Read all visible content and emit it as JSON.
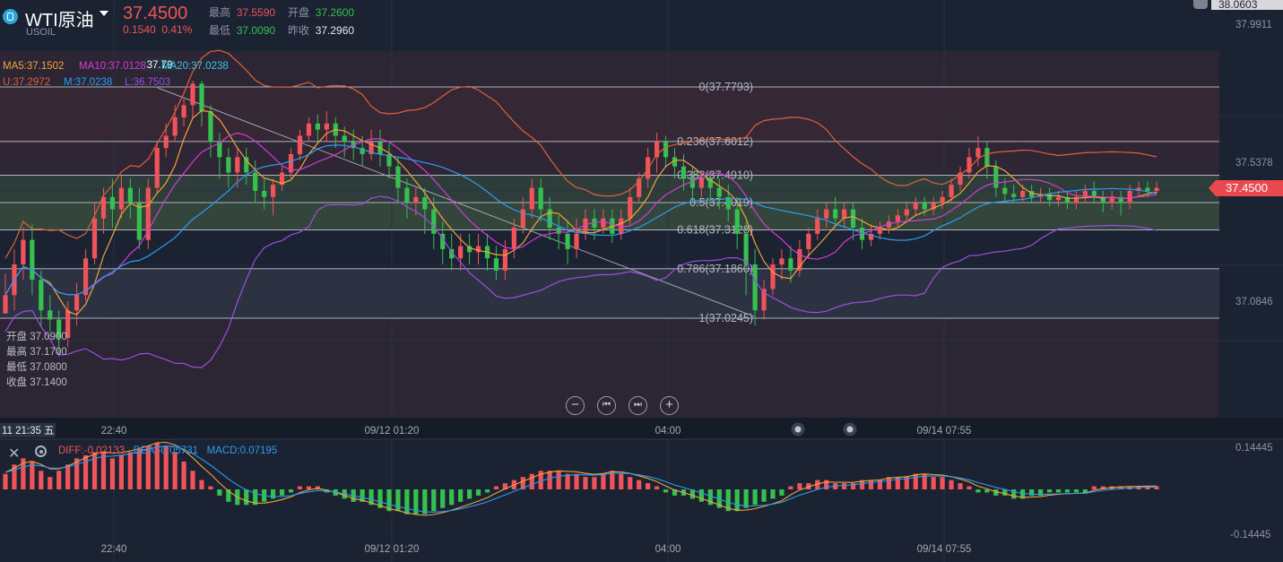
{
  "header": {
    "symbol": "WTI原油",
    "symbol_code": "USOIL",
    "price": "37.4500",
    "change": "0.1540",
    "change_pct": "0.41%",
    "high_label": "最高",
    "high": "37.5590",
    "open_label": "开盘",
    "open": "37.2600",
    "low_label": "最低",
    "low": "37.0090",
    "prev_label": "昨收",
    "prev": "37.2960"
  },
  "indicators": {
    "ma5": "MA5:37.1502",
    "ma10": "MA10:37.0128",
    "ma20": "MA20:37.0238",
    "boll_u": "U:37.2972",
    "boll_m": "M:37.0238",
    "boll_l": "L:36.7503"
  },
  "cursor": {
    "time": "11 21:35 五",
    "open": "开盘 37.0900",
    "high": "最高 37.1700",
    "low": "最低 37.0800",
    "close": "收盘 37.1400"
  },
  "macd": {
    "diff": "DIFF:-0.02133",
    "dea": "DEA:-0.05731",
    "macd": "MACD:0.07195",
    "axis_top": "0.14445",
    "axis_bottom": "-0.14445"
  },
  "controls": {
    "zoom_out": "−",
    "prev": "⏮",
    "next": "⏭",
    "zoom_in": "+"
  },
  "colors": {
    "up": "#f0545a",
    "down": "#35c04f",
    "ma5": "#f3a33b",
    "ma10": "#d53ad8",
    "ma20": "#2d9cf0",
    "boll_u": "#e0603c",
    "boll_l": "#9b4fe0"
  },
  "chart_data": {
    "type": "candlestick",
    "x_tick_labels": [
      "22:40",
      "09/12 01:20",
      "04:00",
      "09/14 07:55"
    ],
    "y_tick_labels": [
      "37.9911",
      "37.5378",
      "37.0846"
    ],
    "y_top_label": "38.0603",
    "current_price": "37.4500",
    "high_marker": "37.79",
    "ylim": [
      36.7,
      38.0
    ],
    "fibonacci": [
      {
        "label": "0(37.7793)",
        "value": 37.7793
      },
      {
        "label": "0.236(37.6012)",
        "value": 37.6012
      },
      {
        "label": "0.382(37.4910)",
        "value": 37.491
      },
      {
        "label": "0.5(37.4019)",
        "value": 37.4019
      },
      {
        "label": "0.618(37.3128)",
        "value": 37.3128
      },
      {
        "label": "0.786(37.1860)",
        "value": 37.186
      },
      {
        "label": "1(37.0245)",
        "value": 37.0245
      }
    ],
    "candles": [
      [
        37.04,
        37.1,
        37.09,
        37.17
      ],
      [
        37.1,
        37.2,
        37.05,
        37.25
      ],
      [
        37.2,
        37.28,
        37.15,
        37.32
      ],
      [
        37.28,
        37.15,
        37.1,
        37.33
      ],
      [
        37.15,
        37.05,
        37.0,
        37.18
      ],
      [
        37.05,
        37.02,
        36.98,
        37.1
      ],
      [
        37.02,
        36.96,
        36.9,
        37.05
      ],
      [
        36.96,
        37.05,
        36.93,
        37.08
      ],
      [
        37.05,
        37.1,
        37.0,
        37.14
      ],
      [
        37.1,
        37.22,
        37.08,
        37.25
      ],
      [
        37.22,
        37.35,
        37.2,
        37.4
      ],
      [
        37.35,
        37.42,
        37.3,
        37.45
      ],
      [
        37.42,
        37.38,
        37.32,
        37.48
      ],
      [
        37.38,
        37.45,
        37.35,
        37.49
      ],
      [
        37.45,
        37.4,
        37.35,
        37.48
      ],
      [
        37.4,
        37.28,
        37.25,
        37.45
      ],
      [
        37.28,
        37.45,
        37.25,
        37.48
      ],
      [
        37.45,
        37.58,
        37.43,
        37.6
      ],
      [
        37.58,
        37.62,
        37.55,
        37.66
      ],
      [
        37.62,
        37.68,
        37.6,
        37.72
      ],
      [
        37.68,
        37.72,
        37.65,
        37.74
      ],
      [
        37.72,
        37.79,
        37.68,
        37.8
      ],
      [
        37.79,
        37.7,
        37.65,
        37.8
      ],
      [
        37.7,
        37.6,
        37.55,
        37.72
      ],
      [
        37.6,
        37.55,
        37.48,
        37.63
      ],
      [
        37.55,
        37.5,
        37.45,
        37.58
      ],
      [
        37.5,
        37.55,
        37.45,
        37.58
      ],
      [
        37.55,
        37.5,
        37.46,
        37.58
      ],
      [
        37.5,
        37.44,
        37.4,
        37.54
      ],
      [
        37.44,
        37.42,
        37.38,
        37.48
      ],
      [
        37.42,
        37.46,
        37.36,
        37.48
      ],
      [
        37.46,
        37.5,
        37.44,
        37.52
      ],
      [
        37.5,
        37.56,
        37.48,
        37.58
      ],
      [
        37.56,
        37.62,
        37.54,
        37.64
      ],
      [
        37.62,
        37.66,
        37.6,
        37.68
      ],
      [
        37.66,
        37.64,
        37.6,
        37.69
      ],
      [
        37.64,
        37.66,
        37.6,
        37.7
      ],
      [
        37.66,
        37.62,
        37.58,
        37.68
      ],
      [
        37.62,
        37.6,
        37.55,
        37.65
      ],
      [
        37.6,
        37.58,
        37.54,
        37.64
      ],
      [
        37.58,
        37.56,
        37.52,
        37.62
      ],
      [
        37.56,
        37.6,
        37.54,
        37.64
      ],
      [
        37.6,
        37.56,
        37.52,
        37.64
      ],
      [
        37.56,
        37.52,
        37.48,
        37.6
      ],
      [
        37.52,
        37.45,
        37.4,
        37.55
      ],
      [
        37.45,
        37.4,
        37.35,
        37.48
      ],
      [
        37.4,
        37.42,
        37.36,
        37.45
      ],
      [
        37.42,
        37.38,
        37.3,
        37.45
      ],
      [
        37.38,
        37.3,
        37.25,
        37.42
      ],
      [
        37.3,
        37.25,
        37.2,
        37.34
      ],
      [
        37.25,
        37.22,
        37.18,
        37.3
      ],
      [
        37.22,
        37.26,
        37.18,
        37.3
      ],
      [
        37.26,
        37.24,
        37.2,
        37.3
      ],
      [
        37.24,
        37.26,
        37.2,
        37.3
      ],
      [
        37.26,
        37.22,
        37.18,
        37.3
      ],
      [
        37.22,
        37.18,
        37.15,
        37.26
      ],
      [
        37.18,
        37.25,
        37.15,
        37.28
      ],
      [
        37.25,
        37.32,
        37.22,
        37.35
      ],
      [
        37.32,
        37.38,
        37.3,
        37.42
      ],
      [
        37.38,
        37.45,
        37.35,
        37.48
      ],
      [
        37.45,
        37.38,
        37.34,
        37.48
      ],
      [
        37.38,
        37.32,
        37.28,
        37.42
      ],
      [
        37.32,
        37.3,
        37.25,
        37.36
      ],
      [
        37.3,
        37.25,
        37.2,
        37.34
      ],
      [
        37.25,
        37.3,
        37.22,
        37.35
      ],
      [
        37.3,
        37.35,
        37.28,
        37.38
      ],
      [
        37.35,
        37.32,
        37.28,
        37.38
      ],
      [
        37.32,
        37.35,
        37.3,
        37.38
      ],
      [
        37.35,
        37.3,
        37.27,
        37.38
      ],
      [
        37.3,
        37.35,
        37.28,
        37.38
      ],
      [
        37.35,
        37.42,
        37.33,
        37.45
      ],
      [
        37.42,
        37.48,
        37.4,
        37.5
      ],
      [
        37.48,
        37.55,
        37.45,
        37.58
      ],
      [
        37.55,
        37.6,
        37.5,
        37.63
      ],
      [
        37.6,
        37.55,
        37.52,
        37.62
      ],
      [
        37.55,
        37.52,
        37.48,
        37.58
      ],
      [
        37.52,
        37.48,
        37.44,
        37.56
      ],
      [
        37.48,
        37.45,
        37.4,
        37.52
      ],
      [
        37.45,
        37.48,
        37.42,
        37.5
      ],
      [
        37.48,
        37.45,
        37.4,
        37.5
      ],
      [
        37.45,
        37.42,
        37.38,
        37.48
      ],
      [
        37.42,
        37.38,
        37.34,
        37.46
      ],
      [
        37.38,
        37.3,
        37.25,
        37.42
      ],
      [
        37.3,
        37.2,
        37.1,
        37.34
      ],
      [
        37.2,
        37.05,
        37.0,
        37.25
      ],
      [
        37.05,
        37.12,
        37.02,
        37.15
      ],
      [
        37.12,
        37.2,
        37.1,
        37.22
      ],
      [
        37.2,
        37.22,
        37.15,
        37.25
      ],
      [
        37.22,
        37.18,
        37.14,
        37.26
      ],
      [
        37.18,
        37.25,
        37.16,
        37.28
      ],
      [
        37.25,
        37.3,
        37.22,
        37.32
      ],
      [
        37.3,
        37.35,
        37.28,
        37.38
      ],
      [
        37.35,
        37.38,
        37.32,
        37.4
      ],
      [
        37.38,
        37.35,
        37.32,
        37.42
      ],
      [
        37.35,
        37.38,
        37.32,
        37.4
      ],
      [
        37.38,
        37.32,
        37.28,
        37.4
      ],
      [
        37.32,
        37.28,
        37.25,
        37.35
      ],
      [
        37.28,
        37.3,
        37.26,
        37.33
      ],
      [
        37.3,
        37.32,
        37.28,
        37.34
      ],
      [
        37.32,
        37.34,
        37.3,
        37.36
      ],
      [
        37.34,
        37.36,
        37.32,
        37.38
      ],
      [
        37.36,
        37.38,
        37.34,
        37.4
      ],
      [
        37.38,
        37.4,
        37.36,
        37.42
      ],
      [
        37.4,
        37.38,
        37.36,
        37.42
      ],
      [
        37.38,
        37.4,
        37.36,
        37.42
      ],
      [
        37.4,
        37.42,
        37.38,
        37.44
      ],
      [
        37.42,
        37.46,
        37.4,
        37.48
      ],
      [
        37.46,
        37.5,
        37.44,
        37.52
      ],
      [
        37.5,
        37.55,
        37.48,
        37.58
      ],
      [
        37.55,
        37.58,
        37.52,
        37.62
      ],
      [
        37.58,
        37.52,
        37.48,
        37.6
      ],
      [
        37.52,
        37.45,
        37.42,
        37.54
      ],
      [
        37.45,
        37.43,
        37.4,
        37.48
      ],
      [
        37.43,
        37.42,
        37.4,
        37.46
      ],
      [
        37.42,
        37.44,
        37.4,
        37.46
      ],
      [
        37.44,
        37.42,
        37.4,
        37.46
      ],
      [
        37.42,
        37.43,
        37.4,
        37.45
      ],
      [
        37.43,
        37.41,
        37.39,
        37.45
      ],
      [
        37.41,
        37.42,
        37.39,
        37.44
      ],
      [
        37.42,
        37.4,
        37.38,
        37.44
      ],
      [
        37.4,
        37.42,
        37.38,
        37.44
      ],
      [
        37.42,
        37.44,
        37.4,
        37.46
      ],
      [
        37.44,
        37.42,
        37.4,
        37.47
      ],
      [
        37.42,
        37.4,
        37.37,
        37.44
      ],
      [
        37.4,
        37.42,
        37.38,
        37.44
      ],
      [
        37.42,
        37.4,
        37.36,
        37.44
      ],
      [
        37.4,
        37.44,
        37.38,
        37.46
      ],
      [
        37.44,
        37.45,
        37.42,
        37.47
      ],
      [
        37.45,
        37.44,
        37.42,
        37.47
      ],
      [
        37.44,
        37.45,
        37.43,
        37.47
      ]
    ],
    "macd_hist": [
      0.05,
      0.08,
      0.1,
      0.09,
      0.06,
      0.04,
      0.06,
      0.08,
      0.1,
      0.11,
      0.12,
      0.12,
      0.1,
      0.11,
      0.12,
      0.13,
      0.14,
      0.15,
      0.14,
      0.12,
      0.09,
      0.06,
      0.03,
      0.01,
      -0.02,
      -0.04,
      -0.05,
      -0.05,
      -0.05,
      -0.04,
      -0.03,
      -0.02,
      -0.01,
      0.01,
      0.01,
      0.01,
      -0.01,
      -0.02,
      -0.03,
      -0.04,
      -0.04,
      -0.05,
      -0.06,
      -0.07,
      -0.07,
      -0.08,
      -0.08,
      -0.08,
      -0.07,
      -0.06,
      -0.05,
      -0.04,
      -0.03,
      -0.02,
      -0.01,
      0.01,
      0.02,
      0.03,
      0.04,
      0.05,
      0.06,
      0.06,
      0.06,
      0.05,
      0.05,
      0.04,
      0.04,
      0.05,
      0.06,
      0.05,
      0.04,
      0.03,
      0.02,
      0.01,
      -0.01,
      -0.02,
      -0.02,
      -0.03,
      -0.04,
      -0.05,
      -0.06,
      -0.07,
      -0.07,
      -0.06,
      -0.05,
      -0.04,
      -0.03,
      -0.02,
      0.01,
      0.02,
      0.02,
      0.03,
      0.03,
      0.02,
      0.02,
      0.02,
      0.03,
      0.03,
      0.03,
      0.04,
      0.04,
      0.04,
      0.05,
      0.05,
      0.04,
      0.04,
      0.03,
      0.02,
      0.01,
      -0.01,
      -0.01,
      -0.02,
      -0.02,
      -0.03,
      -0.03,
      -0.02,
      -0.02,
      -0.01,
      -0.01,
      -0.01,
      -0.01,
      -0.01,
      0.01,
      0.01,
      0.01,
      0.01,
      0.01,
      0.01,
      0.01,
      0.01
    ]
  }
}
